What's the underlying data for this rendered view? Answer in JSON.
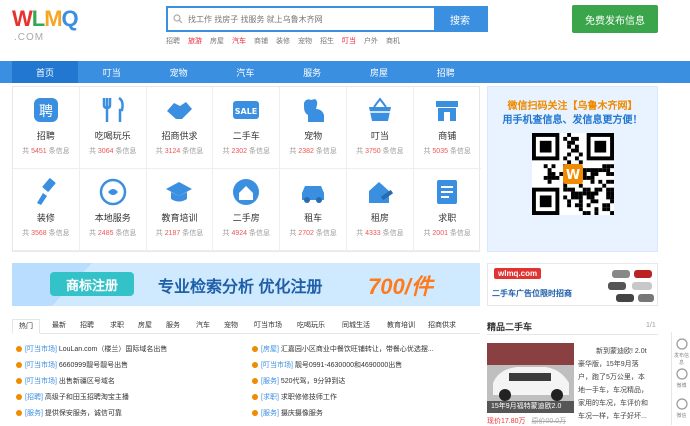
{
  "header": {
    "logo": "WLMQ",
    "logo_domain": ".COM",
    "search_placeholder": "找工作 找房子 找服务 就上乌鲁木齐网",
    "search_button": "搜索",
    "hot_links": [
      {
        "label": "招聘",
        "highlight": false
      },
      {
        "label": "旅游",
        "highlight": true
      },
      {
        "label": "房屋",
        "highlight": false
      },
      {
        "label": "汽车",
        "highlight": true
      },
      {
        "label": "商铺",
        "highlight": false
      },
      {
        "label": "装修",
        "highlight": false
      },
      {
        "label": "宠物",
        "highlight": false
      },
      {
        "label": "招生",
        "highlight": false
      },
      {
        "label": "叮当",
        "highlight": true
      },
      {
        "label": "户外",
        "highlight": false
      },
      {
        "label": "商机",
        "highlight": false
      }
    ],
    "publish_button": "免费发布信息"
  },
  "nav": [
    "首页",
    "叮当",
    "宠物",
    "汽车",
    "服务",
    "房屋",
    "招聘"
  ],
  "categories": [
    {
      "name": "招聘",
      "count": "5451",
      "icon": "hire-icon"
    },
    {
      "name": "吃喝玩乐",
      "count": "3064",
      "icon": "dining-icon"
    },
    {
      "name": "招商供求",
      "count": "3124",
      "icon": "handshake-icon"
    },
    {
      "name": "二手车",
      "count": "2302",
      "icon": "sale-tag-icon"
    },
    {
      "name": "宠物",
      "count": "2382",
      "icon": "dog-icon"
    },
    {
      "name": "叮当",
      "count": "3750",
      "icon": "basket-icon"
    },
    {
      "name": "商铺",
      "count": "5035",
      "icon": "shop-icon"
    },
    {
      "name": "装修",
      "count": "3568",
      "icon": "brush-icon"
    },
    {
      "name": "本地服务",
      "count": "2485",
      "icon": "service-icon"
    },
    {
      "name": "教育培训",
      "count": "2187",
      "icon": "graduation-cap-icon"
    },
    {
      "name": "二手房",
      "count": "4924",
      "icon": "house-icon"
    },
    {
      "name": "租车",
      "count": "2702",
      "icon": "car-icon"
    },
    {
      "name": "租房",
      "count": "4333",
      "icon": "key-house-icon"
    },
    {
      "name": "求职",
      "count": "2001",
      "icon": "resume-icon"
    }
  ],
  "count_prefix": "共",
  "count_suffix": "条信息",
  "qr_panel": {
    "line1": "微信扫码关注【乌鲁木齐网】",
    "line2": "用手机查信息、发信息更方便！",
    "badge": "W"
  },
  "banner": {
    "label": "商标注册",
    "text": "专业检索分析 优化注册",
    "price": "700/件"
  },
  "side_banner": {
    "site": "wlmq.com",
    "text": "二手车广告位限时招商"
  },
  "tabs": [
    "热门",
    "最新",
    "招聘",
    "求职",
    "房屋",
    "服务",
    "汽车",
    "宠物",
    "叮当市场",
    "吃喝玩乐",
    "同城生活",
    "教育培训",
    "招商供求"
  ],
  "news_left": [
    {
      "tag": "[叮当市场]",
      "text": "LouLan.com（楼兰）国际域名出售"
    },
    {
      "tag": "[叮当市场]",
      "text": "6660999靓号靓号出售"
    },
    {
      "tag": "[叮当市场]",
      "text": "出售新疆区号域名"
    },
    {
      "tag": "[招聘]",
      "text": "高级子和田玉招聘淘宝主播"
    },
    {
      "tag": "[服务]",
      "text": "提供保安服务，诚信可靠"
    }
  ],
  "news_right": [
    {
      "tag": "[房屋]",
      "text": "汇嘉园小区商业中餐饮旺铺转让，带餐心优选摆..."
    },
    {
      "tag": "[叮当市场]",
      "text": "靓号0991-4630000和4690000出售"
    },
    {
      "tag": "[服务]",
      "text": "520代驾，9分钟到达"
    },
    {
      "tag": "[求职]",
      "text": "求职修修技师工作"
    },
    {
      "tag": "[服务]",
      "text": "摄庆摄像服务"
    }
  ],
  "second_hand": {
    "title": "精品二手车",
    "page": "1/1",
    "caption": "15年9月福特蒙迪欧2.0",
    "price": "现价17.80万",
    "old_price": "原价00.0万",
    "desc_head": "新到蒙迪欧! 2.0t",
    "desc_lines": [
      "豪华版，15年9月落",
      "户，跑了5万公里，本",
      "地一手车，车况精品，",
      "家用的车况，车评价和",
      "车况一样，车子好坏..."
    ]
  },
  "side_tools": [
    "发布信息",
    "微博",
    "微信"
  ],
  "colors": {
    "brand_blue": "#3b8fe0",
    "nav_active": "#2277d0",
    "publish_green": "#3aa54a",
    "accent_orange": "#f08a00",
    "red": "#e23333"
  }
}
